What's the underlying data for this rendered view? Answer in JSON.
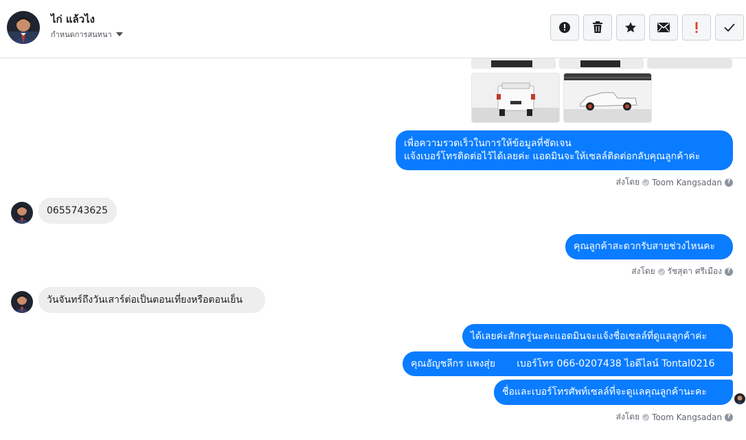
{
  "header": {
    "contact_name": "ไก่ แล้วไง",
    "assign_label": "กำหนดการสนทนา"
  },
  "toolbar": [
    {
      "name": "mark-spam-button",
      "icon": "alert-circle-icon"
    },
    {
      "name": "delete-button",
      "icon": "trash-icon"
    },
    {
      "name": "star-button",
      "icon": "star-icon"
    },
    {
      "name": "mark-unread-button",
      "icon": "envelope-icon"
    },
    {
      "name": "flag-button",
      "icon": "exclamation-icon"
    },
    {
      "name": "mark-done-button",
      "icon": "checkmark-icon"
    }
  ],
  "messages": {
    "m1_line1": "เพื่อความรวดเร็วในการให้ข้อมูลที่ชัดเจน",
    "m1_line2": "แจ้งเบอร์โทรติดต่อไว้ได้เลยค่ะ แอดมินจะให้เซลล์ติดต่อกลับคุณลูกค้าค่ะ",
    "m2": "0655743625",
    "m3": "คุณลูกค้าสะดวกรับสายช่วงไหนคะ",
    "m4": "วันจันทร์ถึงวันเสาร์ต่อเป็นตอนเที่ยงหรือตอนเย็น",
    "m5": "ได้เลยค่ะสักครู่นะคะแอดมินจะแจ้งชื่อเซลล์ที่ดูแลลูกค้าค่ะ",
    "m6": "คุณอัญชลีกร แพงสุ่ย       เบอร์โทร 066-0207438 ไอดีไลน์ Tontal0216",
    "m7": "ชื่อและเบอร์โทรศัพท์เซลล์ที่จะดูแลคุณลูกค้านะคะ"
  },
  "meta": {
    "sent_by": "ส่งโดย",
    "sender_1": "Toom Kangsadan",
    "sender_2": "รัชสุดา ศรีเมือง",
    "sender_3": "Toom Kangsadan",
    "help": "?"
  },
  "colors": {
    "outgoing": "#0a7cff",
    "incoming": "#eeeeee",
    "border": "#dddfe2"
  }
}
